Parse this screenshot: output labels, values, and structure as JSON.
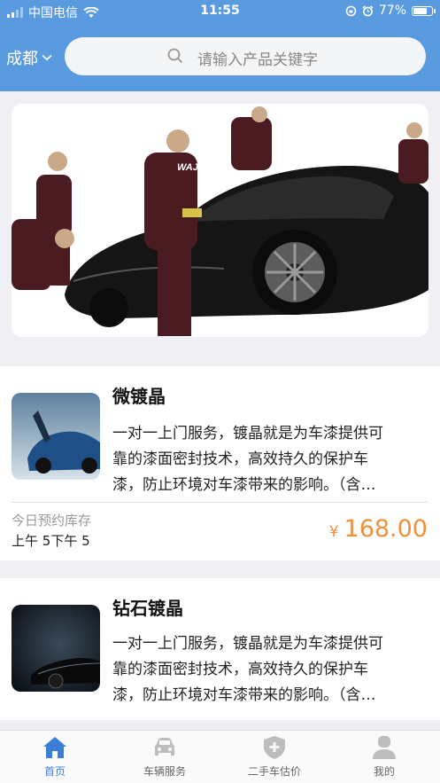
{
  "status_bar": {
    "carrier": "中国电信",
    "time": "11:55",
    "battery": "77%",
    "battery_level": 0.77
  },
  "header": {
    "city": "成都",
    "search_placeholder": "请输入产品关键字"
  },
  "products": [
    {
      "title": "微镀晶",
      "description": "一对一上门服务，镀晶就是为车漆提供可靠的漆面密封技术，高效持久的保护车漆，防止环境对车漆带来的影响。（含…",
      "desc_lines": [
        "一对一上门服务，镀晶就是为车漆提供可",
        "靠的漆面密封技术，高效持久的保护车",
        "漆，防止环境对车漆带来的影响。（含…"
      ],
      "stock_label": "今日预约库存",
      "slots": [
        "上午 5",
        "下午 5"
      ],
      "currency": "¥",
      "price": "168.00"
    },
    {
      "title": "钻石镀晶",
      "desc_lines": [
        "一对一上门服务，镀晶就是为车漆提供可",
        "靠的漆面密封技术，高效持久的保护车",
        "漆，防止环境对车漆带来的影响。（含…"
      ]
    }
  ],
  "tabs": [
    {
      "label": "首页",
      "icon": "home-icon",
      "active": true
    },
    {
      "label": "车辆服务",
      "icon": "car-icon",
      "active": false
    },
    {
      "label": "二手车估价",
      "icon": "shield-plus-icon",
      "active": false
    },
    {
      "label": "我的",
      "icon": "user-icon",
      "active": false
    }
  ],
  "colors": {
    "header_blue": "#5a9be0",
    "price_orange": "#f0903a",
    "tab_active": "#3a7fd5",
    "tab_inactive": "#999999"
  }
}
